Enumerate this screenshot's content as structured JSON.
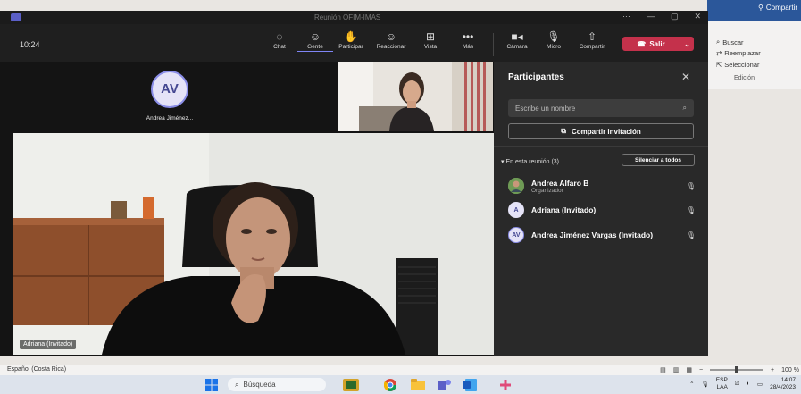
{
  "word": {
    "share_label": "Compartir",
    "commands": [
      "Buscar",
      "Reemplazar",
      "Seleccionar"
    ],
    "group_label": "Edición",
    "status_language": "Español (Costa Rica)",
    "zoom_text": "100 %"
  },
  "teams": {
    "window_title": "Reunión OFIM-IMAS",
    "clock": "10:24",
    "toolbar": {
      "chat": "Chat",
      "people": "Gente",
      "raise": "Participar",
      "react": "Reaccionar",
      "view": "Vista",
      "more": "Más",
      "camera": "Cámara",
      "mic": "Micro",
      "share": "Compartir",
      "leave": "Salir"
    },
    "stage": {
      "avatar_initials": "AV",
      "avatar_name": "Andrea Jiménez...",
      "main_name_tag": "Adriana (Invitado)"
    },
    "panel": {
      "title": "Participantes",
      "search_placeholder": "Escribe un nombre",
      "invite_label": "Compartir invitación",
      "section_label": "En esta reunión (3)",
      "mute_all_label": "Silenciar a todos",
      "participants": [
        {
          "name": "Andrea Alfaro B",
          "role": "Organizador",
          "initials": ""
        },
        {
          "name": "Adriana (Invitado)",
          "role": "",
          "initials": "A"
        },
        {
          "name": "Andrea Jiménez Vargas (Invitado)",
          "role": "",
          "initials": "AV"
        }
      ]
    }
  },
  "taskbar": {
    "search_label": "Búsqueda",
    "lang_line1": "ESP",
    "lang_line2": "LAA",
    "time": "14:07",
    "date": "28/4/2023"
  },
  "colors": {
    "teams_accent": "#7f85f5",
    "leave_red": "#c4314b",
    "word_blue": "#2b579a"
  }
}
